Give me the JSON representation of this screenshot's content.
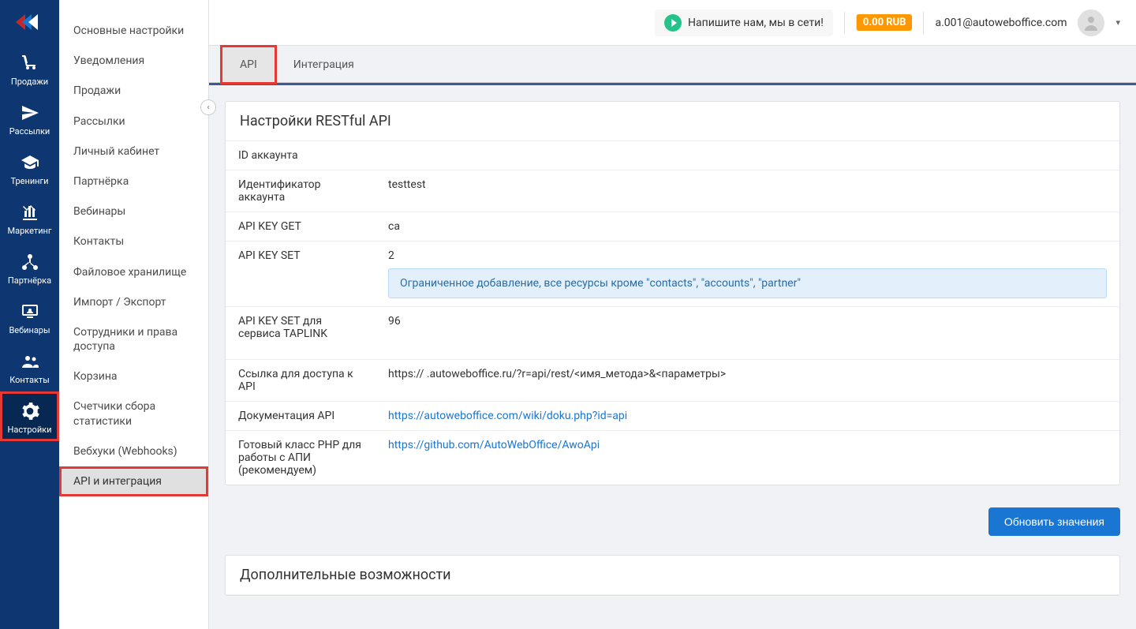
{
  "icon_nav": [
    {
      "label": "Продажи",
      "icon": "cart"
    },
    {
      "label": "Рассылки",
      "icon": "send"
    },
    {
      "label": "Тренинги",
      "icon": "grad"
    },
    {
      "label": "Маркетинг",
      "icon": "stats"
    },
    {
      "label": "Партнёрка",
      "icon": "tree"
    },
    {
      "label": "Вебинары",
      "icon": "webinar"
    },
    {
      "label": "Контакты",
      "icon": "people"
    },
    {
      "label": "Настройки",
      "icon": "gear",
      "active": true,
      "highlight": true
    }
  ],
  "text_nav": [
    "Основные настройки",
    "Уведомления",
    "Продажи",
    "Рассылки",
    "Личный кабинет",
    "Партнёрка",
    "Вебинары",
    "Контакты",
    "Файловое хранилище",
    "Импорт / Экспорт",
    "Сотрудники и права доступа",
    "Корзина",
    "Счетчики сбора статистики",
    "Вебхуки (Webhooks)",
    "API и интеграция"
  ],
  "text_nav_active": 14,
  "topbar": {
    "chat": "Напишите нам, мы в сети!",
    "balance": "0.00 RUB",
    "email": "a.001@autoweboffice.com"
  },
  "tabs": [
    {
      "label": "API",
      "active": true,
      "highlight": true
    },
    {
      "label": "Интеграция"
    }
  ],
  "panel1": {
    "title": "Настройки RESTful API",
    "rows": {
      "account_id_label": "ID аккаунта",
      "account_id_value": "       ",
      "ident_label": "Идентификатор аккаунта",
      "ident_value": "testtest",
      "key_get_label": "API KEY GET",
      "key_get_value": "ca",
      "key_set_label": "API KEY SET",
      "key_set_value": "2",
      "key_set_info": "Ограниченное добавление, все ресурсы кроме \"contacts\", \"accounts\", \"partner\"",
      "key_taplink_label": "API KEY SET для сервиса TAPLINK",
      "key_taplink_value": "96"
    },
    "rows2": {
      "link_label": "Ссылка для доступа к API",
      "link_value": "https://            .autoweboffice.ru/?r=api/rest/<имя_метода>&<параметры>",
      "doc_label": "Документация API",
      "doc_value": "https://autoweboffice.com/wiki/doku.php?id=api",
      "php_label": "Готовый класс PHP для работы с АПИ (рекомендуем)",
      "php_value": "https://github.com/AutoWebOffice/AwoApi"
    }
  },
  "update_button": "Обновить значения",
  "panel2_title": "Дополнительные возможности"
}
